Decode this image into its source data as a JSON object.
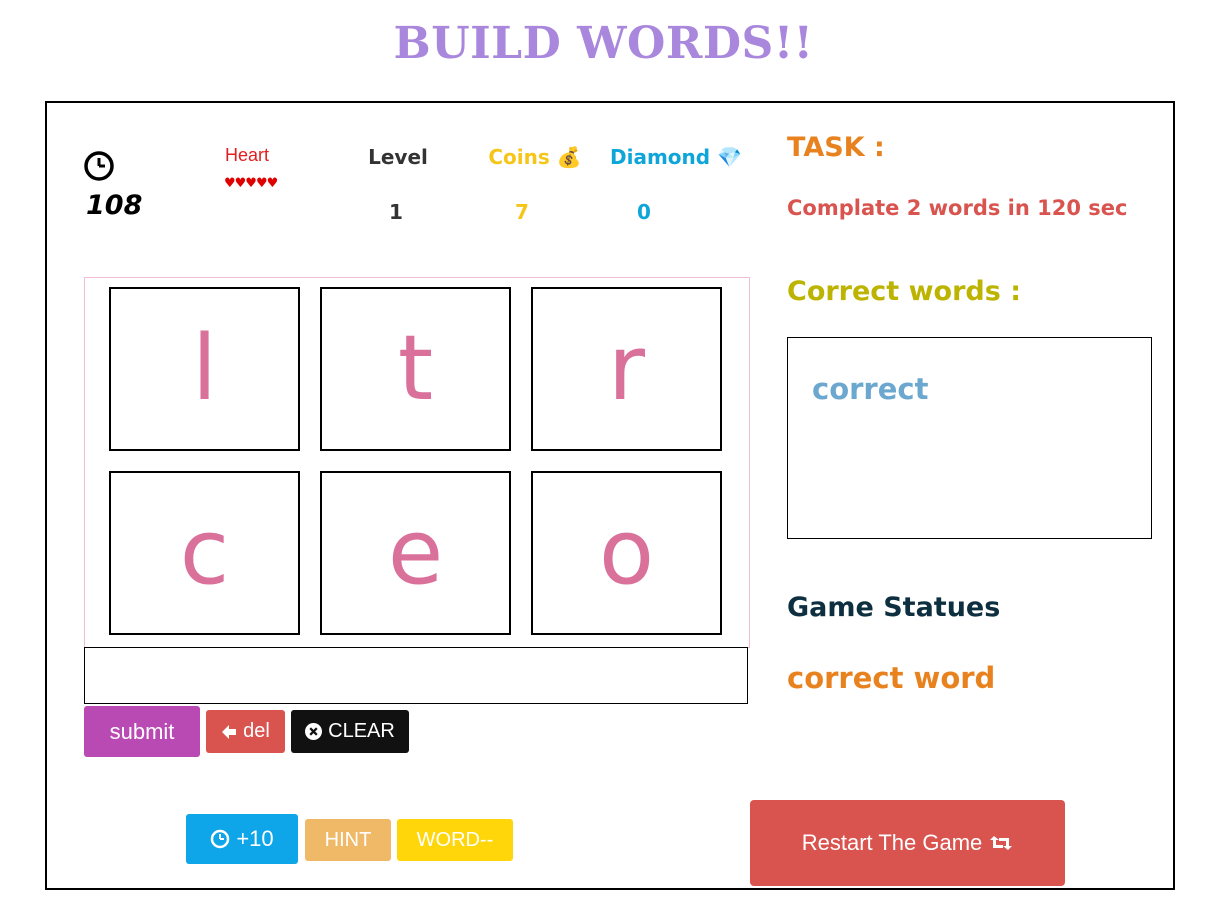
{
  "title": "BUILD WORDS!!",
  "stats": {
    "timer": "108",
    "heart_label": "Heart",
    "hearts": "♥♥♥♥♥",
    "level_label": "Level",
    "level": "1",
    "coins_label": "Coins 💰",
    "coins": "7",
    "diamond_label": "Diamond 💎",
    "diamond": "0"
  },
  "task": {
    "title": "TASK :",
    "text": "Complate 2 words in 120 sec"
  },
  "correct": {
    "title": "Correct words :",
    "words": [
      "correct"
    ]
  },
  "status": {
    "title": "Game Statues",
    "text": "correct word"
  },
  "tiles": [
    "l",
    "t",
    "r",
    "c",
    "e",
    "o"
  ],
  "answer": "",
  "buttons": {
    "submit": "submit",
    "del": "del",
    "clear": "CLEAR",
    "time": "+10",
    "hint": "HINT",
    "word": "WORD--",
    "restart": "Restart The Game"
  },
  "colors": {
    "title": "#a987dd",
    "tile_letter": "#d9719a",
    "restart": "#d9534f"
  }
}
